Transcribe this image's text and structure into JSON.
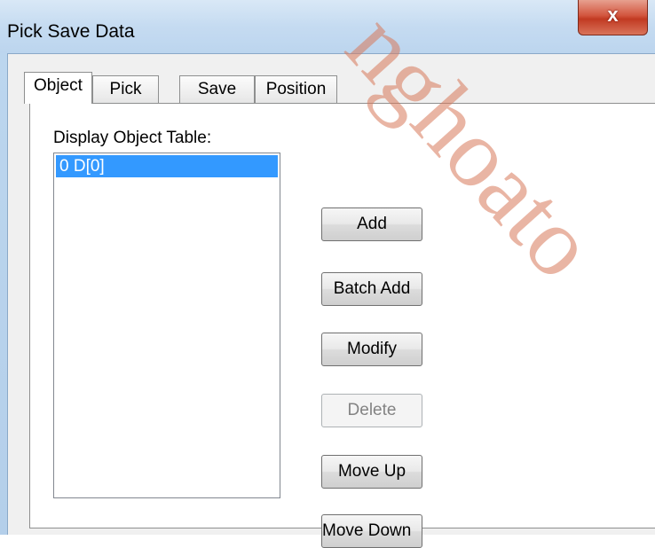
{
  "window": {
    "title": "Pick Save Data",
    "close_glyph": "x"
  },
  "tabs": [
    {
      "label": "Object",
      "active": true
    },
    {
      "label": "Pick",
      "active": false
    },
    {
      "label": "Save",
      "active": false
    },
    {
      "label": "Position",
      "active": false
    }
  ],
  "object_tab": {
    "list_label": "Display Object Table:",
    "items": [
      "0  D[0]"
    ],
    "selected_index": 0,
    "buttons": {
      "add": "Add",
      "batch_add": "Batch Add",
      "modify": "Modify",
      "delete": "Delete",
      "move_up": "Move Up",
      "move_down": "Move Down"
    }
  },
  "watermark": "nghoato",
  "colors": {
    "selection": "#3399ff",
    "close_button": "#c13a22"
  }
}
